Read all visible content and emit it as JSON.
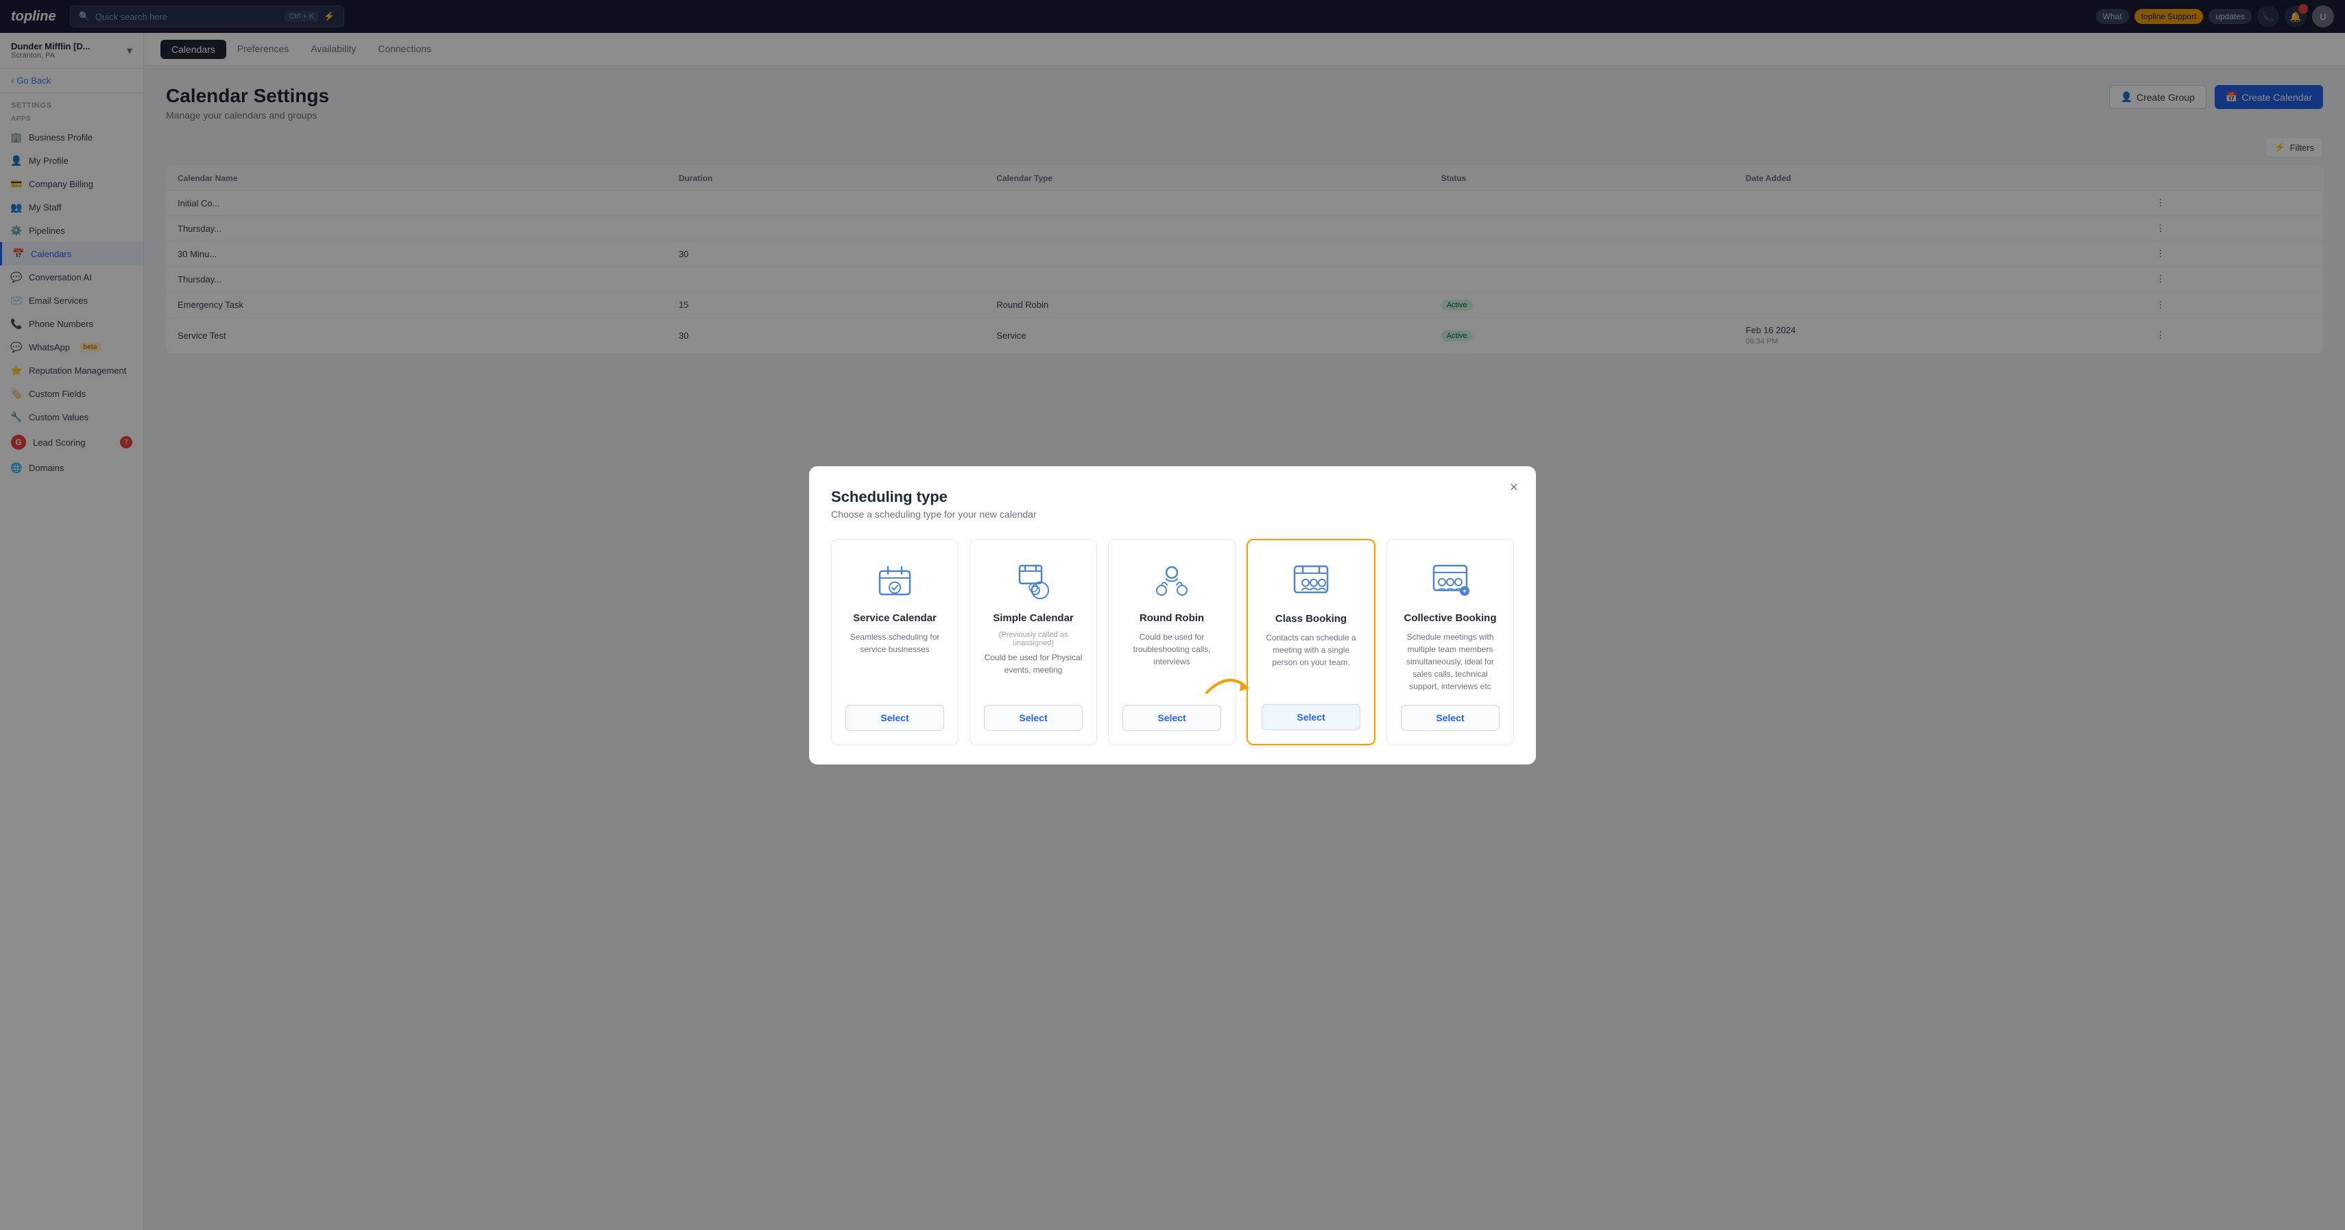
{
  "app": {
    "logo": "topline",
    "search_placeholder": "Quick search here",
    "search_shortcut": "Ctrl + K",
    "lightning_icon": "⚡"
  },
  "topnav": {
    "pill_what": "What",
    "pill_support": "topline Support",
    "pill_updates": "updates",
    "phone_icon": "📞",
    "bell_icon": "🔔",
    "bell_badge": "",
    "avatar_initials": "U"
  },
  "sidebar": {
    "account_name": "Dunder Mifflin [D...",
    "account_sub": "Scranton, PA",
    "go_back": "Go Back",
    "section_label": "Settings",
    "apps_label": "Apps",
    "items": [
      {
        "id": "business-profile",
        "label": "Business Profile",
        "icon": "🏢"
      },
      {
        "id": "my-profile",
        "label": "My Profile",
        "icon": "👤"
      },
      {
        "id": "company-billing",
        "label": "Company Billing",
        "icon": "💳"
      },
      {
        "id": "my-staff",
        "label": "My Staff",
        "icon": "👥"
      },
      {
        "id": "pipelines",
        "label": "Pipelines",
        "icon": "⚙️"
      },
      {
        "id": "calendars",
        "label": "Calendars",
        "icon": "📅",
        "active": true
      },
      {
        "id": "conversation-ai",
        "label": "Conversation AI",
        "icon": "💬"
      },
      {
        "id": "email-services",
        "label": "Email Services",
        "icon": "✉️"
      },
      {
        "id": "phone-numbers",
        "label": "Phone Numbers",
        "icon": "📞"
      },
      {
        "id": "whatsapp",
        "label": "WhatsApp",
        "icon": "💬",
        "badge": "beta"
      },
      {
        "id": "reputation-management",
        "label": "Reputation Management",
        "icon": "⭐"
      },
      {
        "id": "custom-fields",
        "label": "Custom Fields",
        "icon": "🏷️"
      },
      {
        "id": "custom-values",
        "label": "Custom Values",
        "icon": "🔧"
      },
      {
        "id": "lead-scoring",
        "label": "Lead Scoring",
        "icon": "G",
        "badge_num": "7"
      },
      {
        "id": "domains",
        "label": "Domains",
        "icon": "🌐"
      }
    ]
  },
  "content": {
    "tabs": [
      {
        "id": "calendars",
        "label": "Calendars",
        "active": true
      },
      {
        "id": "preferences",
        "label": "Preferences"
      },
      {
        "id": "availability",
        "label": "Availability"
      },
      {
        "id": "connections",
        "label": "Connections"
      }
    ],
    "page_title": "Calendar Settings",
    "page_subtitle": "Manage your calendars and groups",
    "create_group_label": "Create Group",
    "create_calendar_label": "Create Calendar",
    "filters_label": "Filters",
    "table": {
      "headers": [
        "Calendar Name",
        "Duration",
        "Calendar Type",
        "Status",
        "Date Added",
        ""
      ],
      "rows": [
        {
          "name": "Initial Co...",
          "duration": "",
          "type": "",
          "status": "",
          "date": ""
        },
        {
          "name": "Thursday...",
          "duration": "",
          "type": "",
          "status": "",
          "date": ""
        },
        {
          "name": "30 Minu...",
          "duration": "30",
          "type": "",
          "status": "",
          "date": ""
        },
        {
          "name": "Thursday...",
          "duration": "",
          "type": "",
          "status": "",
          "date": ""
        },
        {
          "name": "Emergency Task",
          "duration": "15",
          "type": "Round Robin",
          "status": "Active",
          "date": ""
        },
        {
          "name": "Service Test",
          "duration": "30",
          "type": "Service",
          "status": "Active",
          "date": "Feb 16 2024\n09:34 PM"
        }
      ]
    }
  },
  "modal": {
    "title": "Scheduling type",
    "subtitle": "Choose a scheduling type for your new calendar",
    "close_label": "×",
    "cards": [
      {
        "id": "service-calendar",
        "title": "Service Calendar",
        "description": "Seamless scheduling for service businesses",
        "btn_label": "Select",
        "selected": false
      },
      {
        "id": "simple-calendar",
        "title": "Simple Calendar",
        "subtitle": "(Previously called as unassigned)",
        "description": "Could be used for Physical events, meeting",
        "btn_label": "Select",
        "selected": false
      },
      {
        "id": "round-robin",
        "title": "Round Robin",
        "description": "Could be used for troubleshooting calls, interviews",
        "btn_label": "Select",
        "selected": false
      },
      {
        "id": "class-booking",
        "title": "Class Booking",
        "description": "Contacts can schedule a meeting with a single person on your team.",
        "btn_label": "Select",
        "selected": true
      },
      {
        "id": "collective-booking",
        "title": "Collective Booking",
        "description": "Schedule meetings with multiple team members simultaneously, ideal for sales calls, technical support, interviews etc",
        "btn_label": "Select",
        "selected": false
      }
    ]
  }
}
